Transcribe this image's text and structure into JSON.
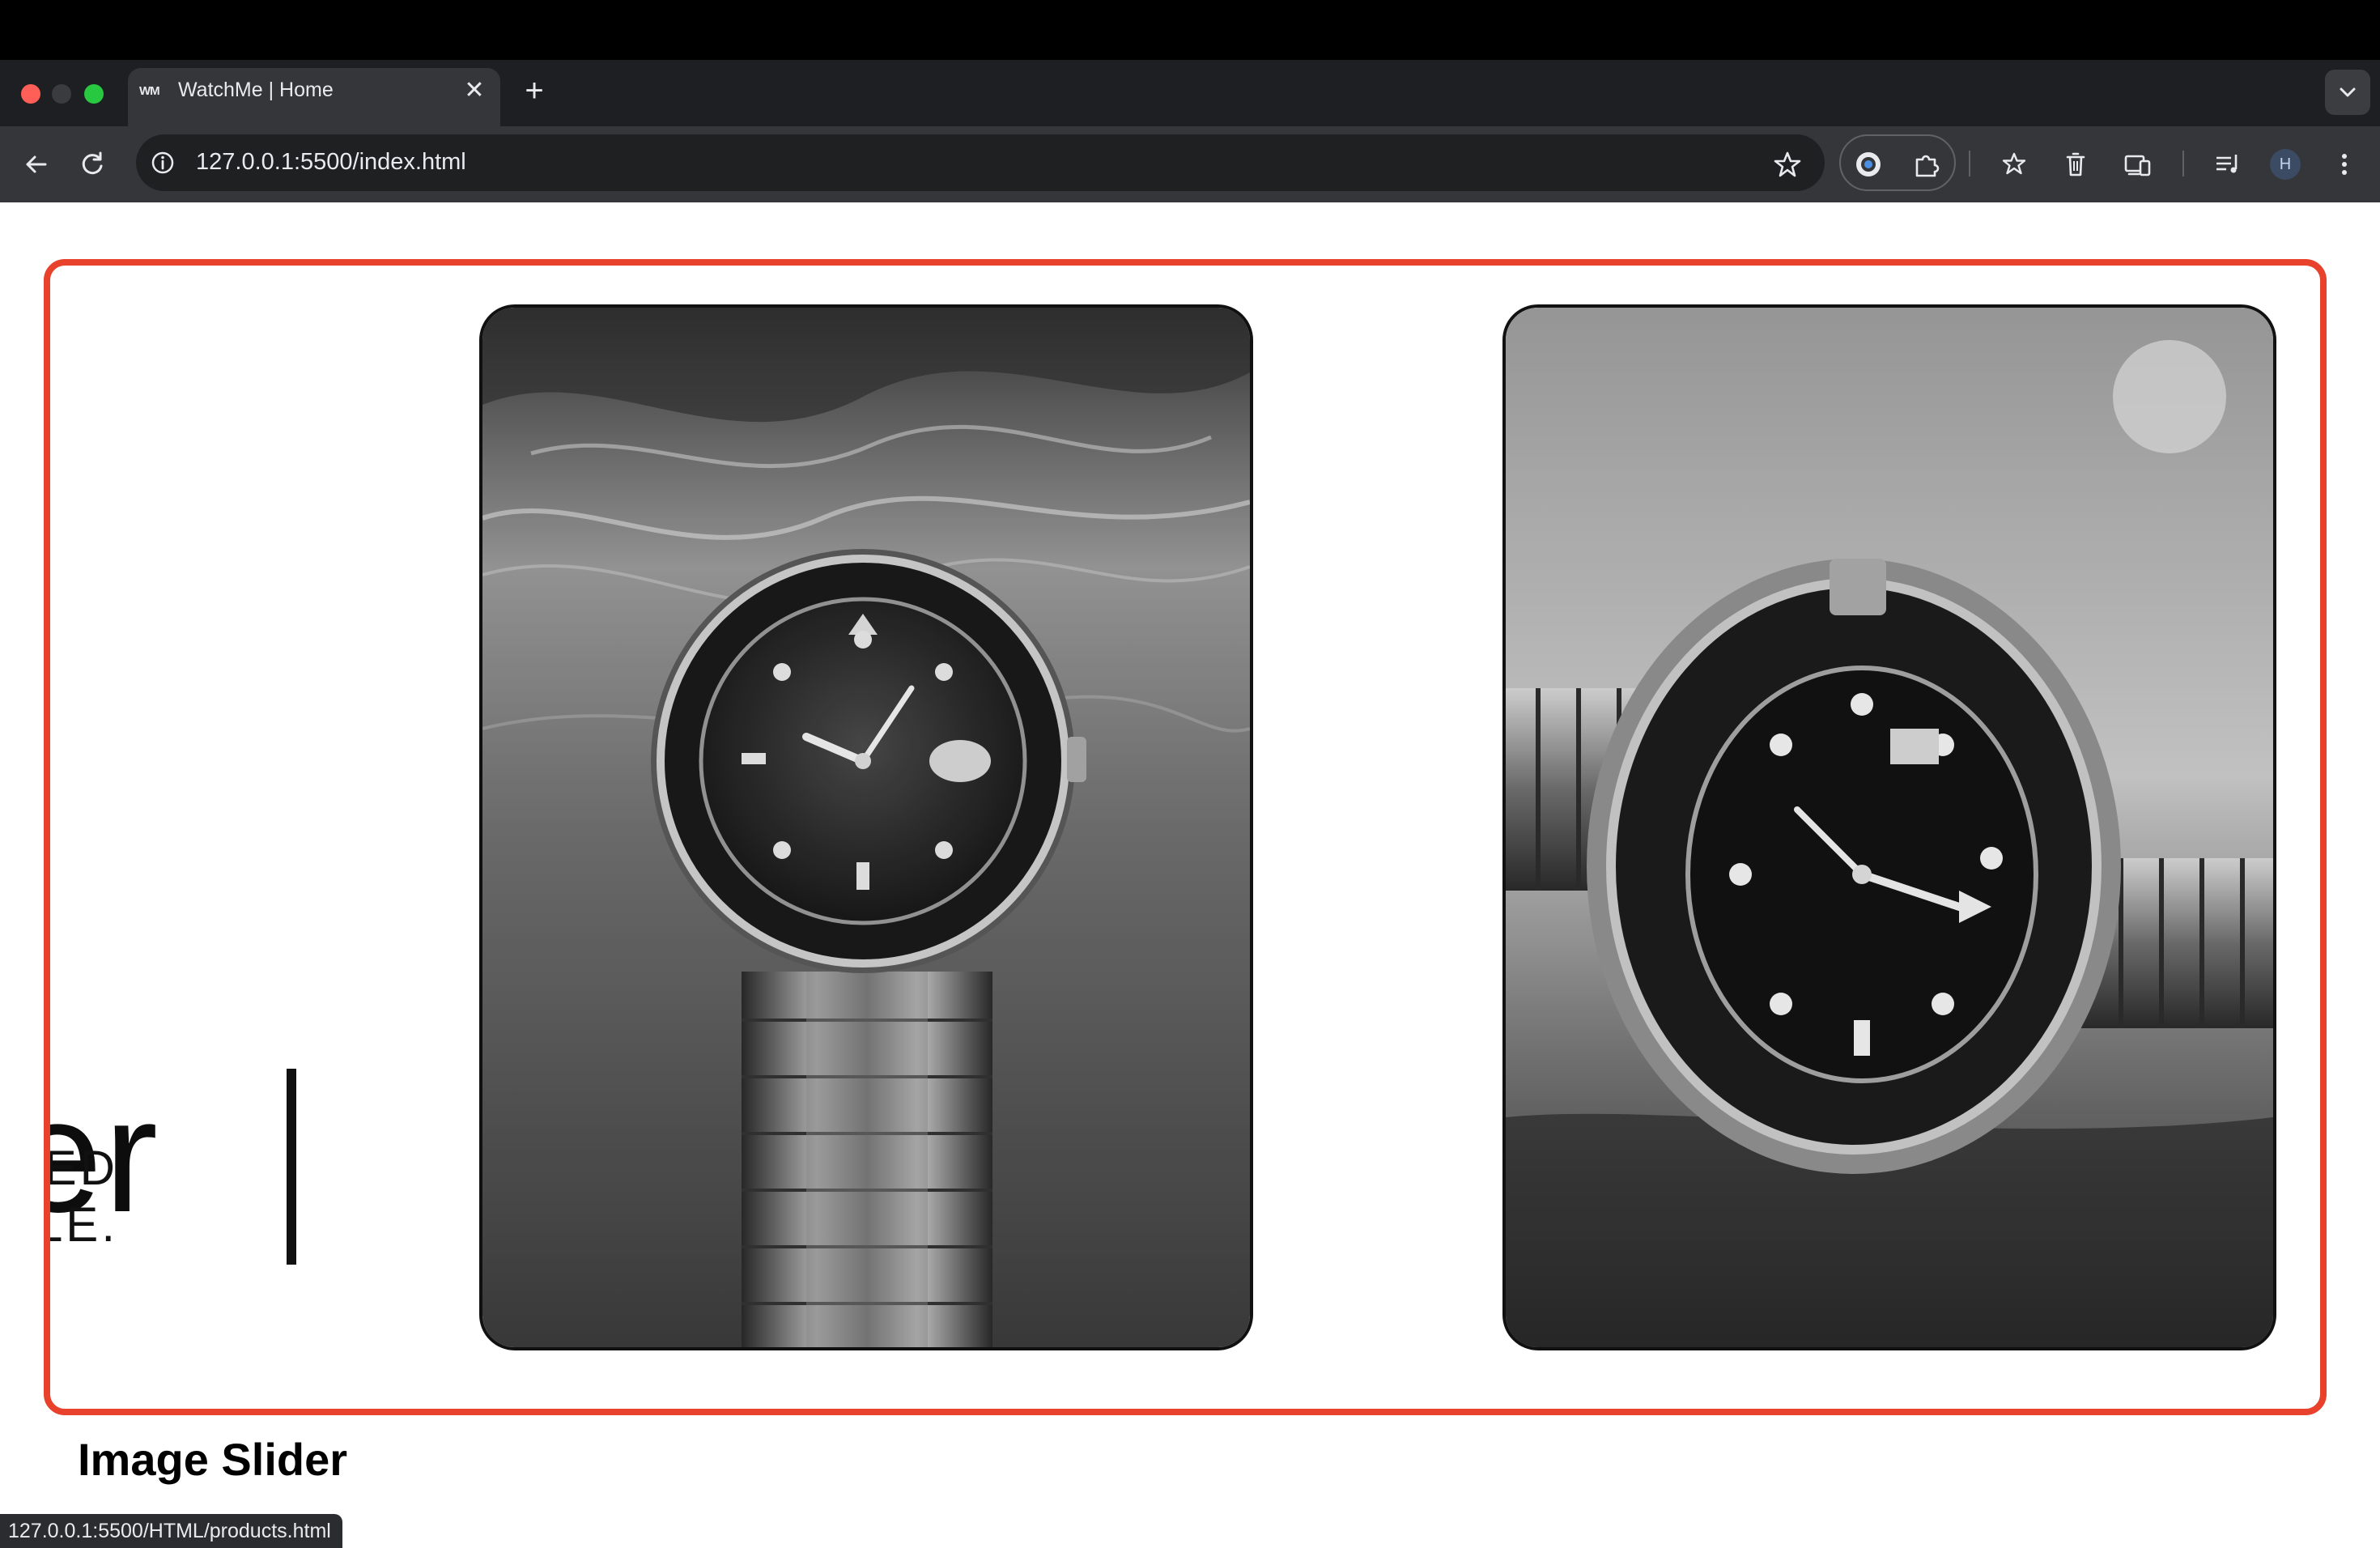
{
  "browser": {
    "tab": {
      "favicon_text": "WM",
      "title": "WatchMe | Home"
    },
    "new_tab_symbol": "+",
    "close_symbol": "✕",
    "url": "127.0.0.1:5500/index.html",
    "profile_initial": "H",
    "status_url": "127.0.0.1:5500/HTML/products.html"
  },
  "slider": {
    "hero_partial_word": "her",
    "tagline": [
      "UGGED",
      "STYLE."
    ],
    "slides": [
      {
        "alt": "Rolex Submariner under water"
      },
      {
        "alt": "Rolex GMT-Master II on jubilee bracelet"
      }
    ]
  },
  "section": {
    "title": "Image Slider"
  },
  "colors": {
    "frame": "#e8412c",
    "chrome_dark": "#1e1f22",
    "toolbar": "#35363a",
    "page_background": "#ffffff"
  }
}
